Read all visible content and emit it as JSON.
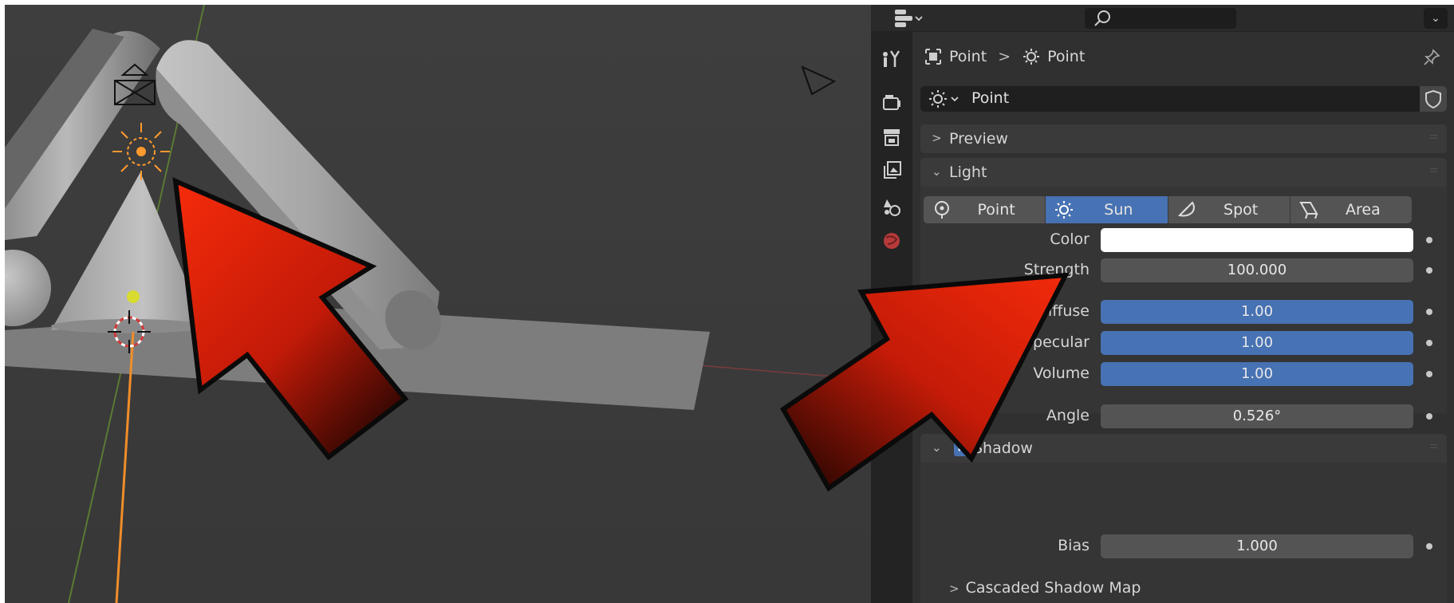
{
  "breadcrumb": {
    "object_name": "Point",
    "separator": ">",
    "data_name": "Point"
  },
  "datablock": {
    "name": "Point"
  },
  "panels": {
    "preview": {
      "label": "Preview",
      "expanded": false
    },
    "light": {
      "label": "Light",
      "expanded": true
    },
    "shadow": {
      "label": "Shadow",
      "enabled": true,
      "check": "✓"
    }
  },
  "light_types": [
    {
      "label": "Point",
      "icon": "point-light-icon",
      "active": false
    },
    {
      "label": "Sun",
      "icon": "sun-icon",
      "active": true
    },
    {
      "label": "Spot",
      "icon": "spot-light-icon",
      "active": false
    },
    {
      "label": "Area",
      "icon": "area-light-icon",
      "active": false
    }
  ],
  "properties": {
    "color": {
      "label": "Color",
      "value": "#ffffff"
    },
    "strength": {
      "label": "Strength",
      "value": "100.000"
    },
    "diffuse": {
      "label": "Diffuse",
      "value": "1.00"
    },
    "specular": {
      "label": "Specular",
      "value": "1.00"
    },
    "volume": {
      "label": "Volume",
      "value": "1.00"
    },
    "angle": {
      "label": "Angle",
      "value": "0.526°"
    },
    "bias": {
      "label": "Bias",
      "value": "1.000"
    }
  },
  "subpanels": {
    "cascaded_shadow_map": "Cascaded Shadow Map"
  },
  "colors": {
    "accent": "#4772b3",
    "arrow_red": "#e82b0d",
    "viewport_bg": "#3b3b3b",
    "panel_bg": "#303030",
    "light_gizmo": "#ffa033",
    "z_axis": "#ffa033",
    "y_axis": "#6f8f3a"
  }
}
